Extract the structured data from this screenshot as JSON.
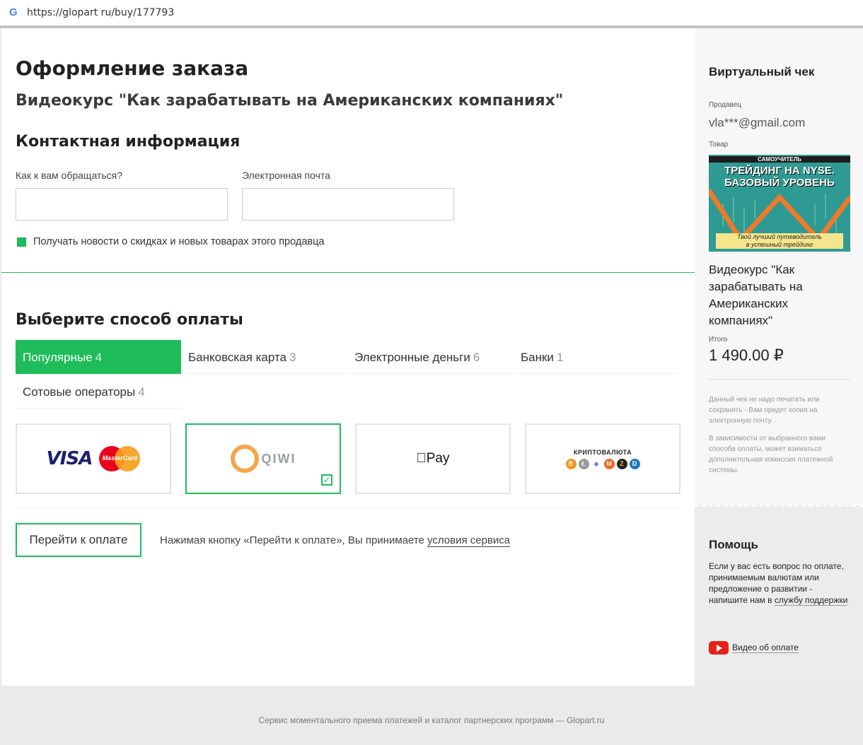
{
  "browser": {
    "url": "https://glopart ru/buy/177793",
    "logo": "G"
  },
  "main": {
    "title": "Оформление заказа",
    "product_title": "Видеокурс \"Как зарабатывать на Американских компаниях\"",
    "contact": {
      "heading": "Контактная информация",
      "name_label": "Как к вам обращаться?",
      "name_value": "",
      "email_label": "Электронная почта",
      "email_value": "",
      "newsletter_label": "Получать новости о скидках и новых товарах этого продавца",
      "newsletter_checked": true
    },
    "payment": {
      "heading": "Выберите способ оплаты",
      "tabs": [
        {
          "label": "Популярные",
          "count": "4",
          "active": true
        },
        {
          "label": "Банковская карта",
          "count": "3",
          "active": false
        },
        {
          "label": "Электронные деньги",
          "count": "6",
          "active": false
        },
        {
          "label": "Банки",
          "count": "1",
          "active": false
        },
        {
          "label": "Сотовые операторы",
          "count": "4",
          "active": false
        }
      ],
      "methods": [
        {
          "name": "visa-mastercard",
          "visa_text": "VISA",
          "mc_text": "MasterCard",
          "selected": false
        },
        {
          "name": "qiwi",
          "text": "QIWI",
          "selected": true
        },
        {
          "name": "apple-pay",
          "text": "Pay",
          "selected": false
        },
        {
          "name": "crypto",
          "text": "КРИПТОВАЛЮТА",
          "selected": false
        }
      ]
    },
    "pay_button": "Перейти к оплате",
    "terms_text": "Нажимая кнопку «Перейти к оплате», Вы принимаете",
    "terms_link": "условия сервиса"
  },
  "receipt": {
    "title": "Виртуальный чек",
    "seller_label": "Продавец",
    "seller": "vla***@gmail.com",
    "product_label": "Товар",
    "promo": {
      "top": "САМОУЧИТЕЛЬ",
      "title_line1": "ТРЕЙДИНГ НА NYSE.",
      "title_line2": "БАЗОВЫЙ УРОВЕНЬ",
      "tagline_line1": "Твой лучший путеводитель",
      "tagline_line2": "в успешный трейдинг"
    },
    "product": "Видеокурс \"Как зарабатывать на Американских компаниях\"",
    "total_label": "Итого",
    "total": "1 490.00 ₽",
    "note1": "Данный чек не надо печатать или сохранять - Вам придет копия на электронную почту.",
    "note2": "В зависимости от выбранного вами способа оплаты, может взиматься дополнительная комиссия платежной системы."
  },
  "help": {
    "title": "Помощь",
    "text": "Если у вас есть вопрос по оплате, принимаемым валютам или предложение о развитии - напишите нам в",
    "link": "службу поддержки",
    "video_label": "Видео об оплате"
  },
  "footer": "Сервис моментального приема платежей и каталог партнерских программ — Glopart.ru",
  "colors": {
    "accent": "#1ebd5a",
    "youtube": "#e62117"
  }
}
